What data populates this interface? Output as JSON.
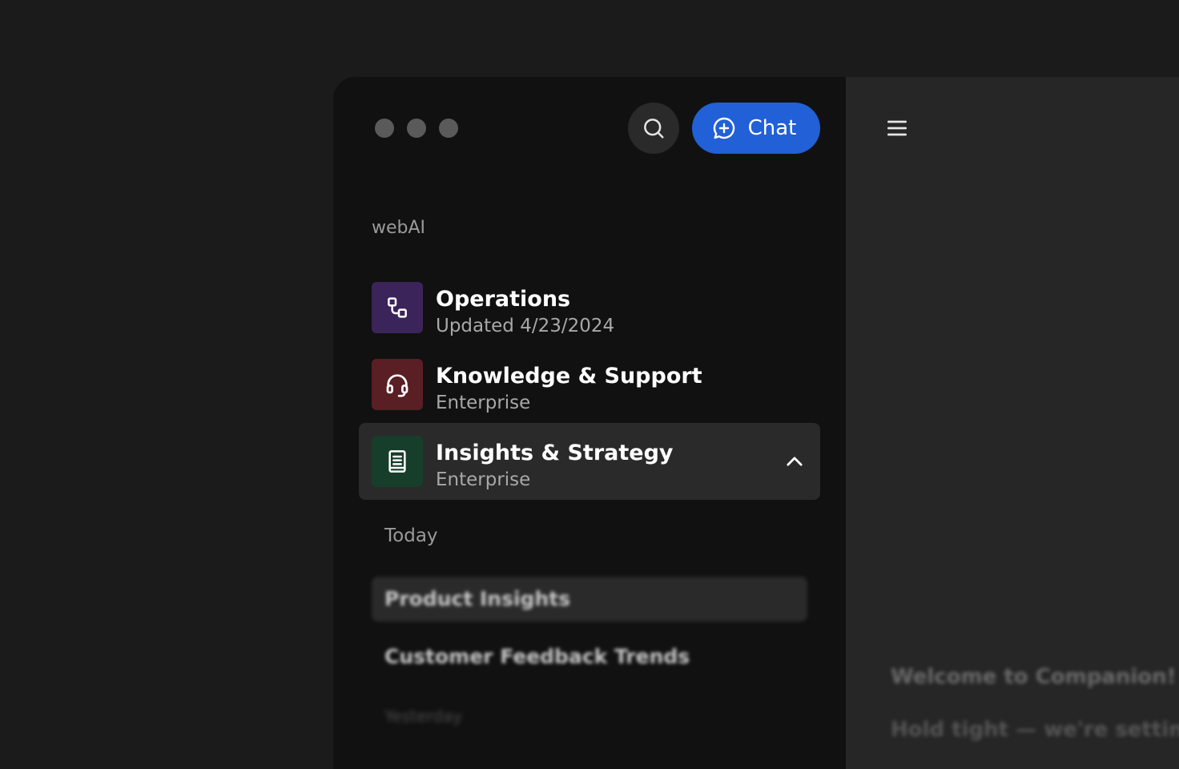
{
  "window": {
    "controls": [
      "close",
      "minimize",
      "maximize"
    ]
  },
  "header": {
    "search_icon": "search-icon",
    "chat_button_label": "Chat",
    "chat_icon": "chat-plus-icon",
    "accent_color": "#2160d6"
  },
  "sidebar": {
    "org_name": "webAI",
    "workspaces": [
      {
        "title": "Operations",
        "subtitle": "Updated 4/23/2024",
        "icon": "workflow-icon",
        "icon_bg": "#3b2459",
        "active": false
      },
      {
        "title": "Knowledge & Support",
        "subtitle": "Enterprise",
        "icon": "headset-icon",
        "icon_bg": "#5a1e25",
        "active": false
      },
      {
        "title": "Insights & Strategy",
        "subtitle": "Enterprise",
        "icon": "document-icon",
        "icon_bg": "#173d2b",
        "active": true
      }
    ],
    "sections": {
      "today_label": "Today",
      "yesterday_label": "Yesterday"
    },
    "chats_today": [
      {
        "title": "Product Insights",
        "selected": true
      },
      {
        "title": "Customer Feedback Trends",
        "selected": false
      }
    ]
  },
  "main": {
    "menu_icon": "hamburger-menu-icon",
    "welcome_title": "Welcome to Companion!",
    "welcome_subtitle": "Hold tight — we're setting u"
  }
}
